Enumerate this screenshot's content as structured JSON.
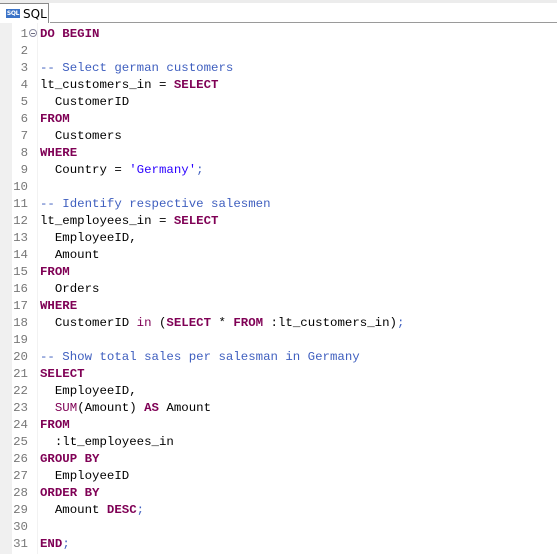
{
  "tab": {
    "icon": "sql-file-icon",
    "icon_text": "SQL",
    "label": "SQL"
  },
  "colors": {
    "keyword": "#7f0055",
    "comment": "#3f5fbf",
    "string": "#2a00ff",
    "line_number": "#787878"
  },
  "lines": [
    {
      "n": "1",
      "fold": true,
      "tokens": [
        {
          "t": "DO BEGIN",
          "c": "kw"
        }
      ]
    },
    {
      "n": "2",
      "tokens": []
    },
    {
      "n": "3",
      "tokens": [
        {
          "t": "-- Select german customers",
          "c": "cm"
        }
      ]
    },
    {
      "n": "4",
      "tokens": [
        {
          "t": "lt_customers_in = ",
          "c": ""
        },
        {
          "t": "SELECT",
          "c": "kw"
        }
      ]
    },
    {
      "n": "5",
      "tokens": [
        {
          "t": "  CustomerID",
          "c": ""
        }
      ]
    },
    {
      "n": "6",
      "tokens": [
        {
          "t": "FROM",
          "c": "kw"
        }
      ]
    },
    {
      "n": "7",
      "tokens": [
        {
          "t": "  Customers",
          "c": ""
        }
      ]
    },
    {
      "n": "8",
      "tokens": [
        {
          "t": "WHERE",
          "c": "kw"
        }
      ]
    },
    {
      "n": "9",
      "tokens": [
        {
          "t": "  Country = ",
          "c": ""
        },
        {
          "t": "'Germany'",
          "c": "str"
        },
        {
          "t": ";",
          "c": "semi"
        }
      ]
    },
    {
      "n": "10",
      "tokens": []
    },
    {
      "n": "11",
      "tokens": [
        {
          "t": "-- Identify respective salesmen",
          "c": "cm"
        }
      ]
    },
    {
      "n": "12",
      "tokens": [
        {
          "t": "lt_employees_in = ",
          "c": ""
        },
        {
          "t": "SELECT",
          "c": "kw"
        }
      ]
    },
    {
      "n": "13",
      "tokens": [
        {
          "t": "  EmployeeID,",
          "c": ""
        }
      ]
    },
    {
      "n": "14",
      "tokens": [
        {
          "t": "  Amount",
          "c": ""
        }
      ]
    },
    {
      "n": "15",
      "tokens": [
        {
          "t": "FROM",
          "c": "kw"
        }
      ]
    },
    {
      "n": "16",
      "tokens": [
        {
          "t": "  Orders",
          "c": ""
        }
      ]
    },
    {
      "n": "17",
      "tokens": [
        {
          "t": "WHERE",
          "c": "kw"
        }
      ]
    },
    {
      "n": "18",
      "tokens": [
        {
          "t": "  CustomerID ",
          "c": ""
        },
        {
          "t": "in",
          "c": "kwn"
        },
        {
          "t": " (",
          "c": ""
        },
        {
          "t": "SELECT",
          "c": "kw"
        },
        {
          "t": " * ",
          "c": ""
        },
        {
          "t": "FROM",
          "c": "kw"
        },
        {
          "t": " :lt_customers_in)",
          "c": ""
        },
        {
          "t": ";",
          "c": "semi"
        }
      ]
    },
    {
      "n": "19",
      "tokens": []
    },
    {
      "n": "20",
      "tokens": [
        {
          "t": "-- Show total sales per salesman in Germany",
          "c": "cm"
        }
      ]
    },
    {
      "n": "21",
      "tokens": [
        {
          "t": "SELECT",
          "c": "kw"
        }
      ]
    },
    {
      "n": "22",
      "tokens": [
        {
          "t": "  EmployeeID,",
          "c": ""
        }
      ]
    },
    {
      "n": "23",
      "tokens": [
        {
          "t": "  ",
          "c": ""
        },
        {
          "t": "SUM",
          "c": "kwn"
        },
        {
          "t": "(Amount) ",
          "c": ""
        },
        {
          "t": "AS",
          "c": "kw"
        },
        {
          "t": " Amount",
          "c": ""
        }
      ]
    },
    {
      "n": "24",
      "tokens": [
        {
          "t": "FROM",
          "c": "kw"
        }
      ]
    },
    {
      "n": "25",
      "tokens": [
        {
          "t": "  :lt_employees_in",
          "c": ""
        }
      ]
    },
    {
      "n": "26",
      "tokens": [
        {
          "t": "GROUP BY",
          "c": "kw"
        }
      ]
    },
    {
      "n": "27",
      "tokens": [
        {
          "t": "  EmployeeID",
          "c": ""
        }
      ]
    },
    {
      "n": "28",
      "tokens": [
        {
          "t": "ORDER BY",
          "c": "kw"
        }
      ]
    },
    {
      "n": "29",
      "tokens": [
        {
          "t": "  Amount ",
          "c": ""
        },
        {
          "t": "DESC",
          "c": "kw"
        },
        {
          "t": ";",
          "c": "semi"
        }
      ]
    },
    {
      "n": "30",
      "tokens": []
    },
    {
      "n": "31",
      "tokens": [
        {
          "t": "END",
          "c": "kw"
        },
        {
          "t": ";",
          "c": "semi"
        }
      ]
    }
  ]
}
